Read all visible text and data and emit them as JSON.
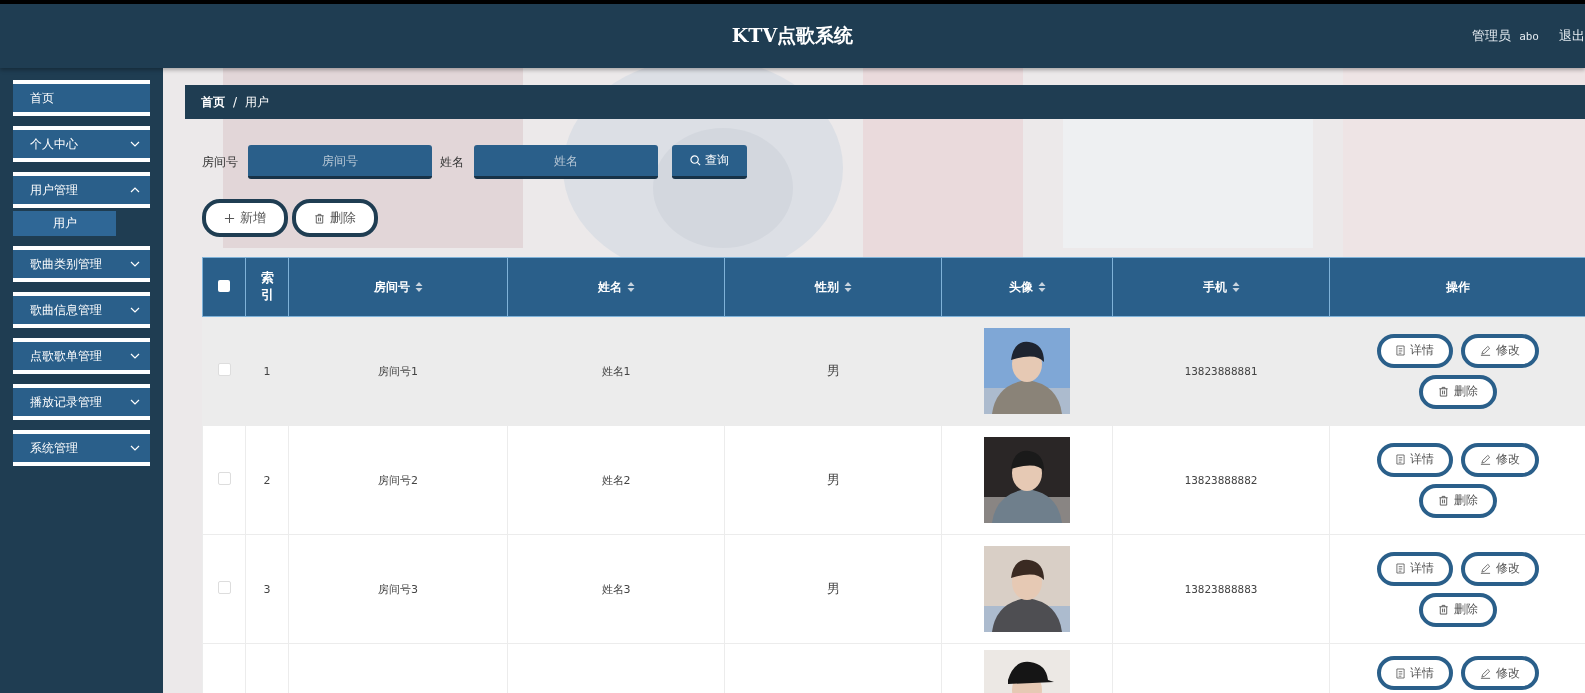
{
  "header": {
    "title": "KTV点歌系统",
    "user_role": "管理员",
    "user_name": "abo",
    "logout": "退出"
  },
  "sidebar": {
    "items": [
      {
        "label": "首页"
      },
      {
        "label": "个人中心",
        "expanded": false
      },
      {
        "label": "用户管理",
        "expanded": true,
        "children": [
          {
            "label": "用户",
            "selected": true
          }
        ]
      },
      {
        "label": "歌曲类别管理",
        "expanded": false
      },
      {
        "label": "歌曲信息管理",
        "expanded": false
      },
      {
        "label": "点歌歌单管理",
        "expanded": false
      },
      {
        "label": "播放记录管理",
        "expanded": false
      },
      {
        "label": "系统管理",
        "expanded": false
      }
    ]
  },
  "breadcrumb": {
    "items": [
      "首页",
      "用户"
    ],
    "separator": "/"
  },
  "search": {
    "fields": [
      {
        "label": "房间号",
        "placeholder": "房间号"
      },
      {
        "label": "姓名",
        "placeholder": "姓名"
      }
    ],
    "button": "查询"
  },
  "actions": [
    {
      "kind": "add",
      "label": "新增"
    },
    {
      "kind": "delete",
      "label": "删除"
    }
  ],
  "table": {
    "select_all_checked": false,
    "columns": [
      {
        "label": "索引",
        "sortable": false
      },
      {
        "label": "房间号",
        "sortable": true
      },
      {
        "label": "姓名",
        "sortable": true
      },
      {
        "label": "性别",
        "sortable": true
      },
      {
        "label": "头像",
        "sortable": true
      },
      {
        "label": "手机",
        "sortable": true
      },
      {
        "label": "操作",
        "sortable": false
      }
    ],
    "rows": [
      {
        "checked": false,
        "hovered": true,
        "index": "1",
        "room": "房间号1",
        "name": "姓名1",
        "gender": "男",
        "phone": "13823888881",
        "buttons": [
          {
            "kind": "detail",
            "label": "详情"
          },
          {
            "kind": "edit",
            "label": "修改"
          },
          {
            "kind": "delete",
            "label": "删除"
          }
        ]
      },
      {
        "checked": false,
        "hovered": false,
        "index": "2",
        "room": "房间号2",
        "name": "姓名2",
        "gender": "男",
        "phone": "13823888882",
        "buttons": [
          {
            "kind": "detail",
            "label": "详情"
          },
          {
            "kind": "edit",
            "label": "修改"
          },
          {
            "kind": "delete",
            "label": "删除"
          }
        ]
      },
      {
        "checked": false,
        "hovered": false,
        "index": "3",
        "room": "房间号3",
        "name": "姓名3",
        "gender": "男",
        "phone": "13823888883",
        "buttons": [
          {
            "kind": "detail",
            "label": "详情"
          },
          {
            "kind": "edit",
            "label": "修改"
          },
          {
            "kind": "delete",
            "label": "删除"
          }
        ]
      }
    ],
    "partial_row": {
      "buttons": [
        {
          "kind": "detail",
          "label": "详情"
        },
        {
          "kind": "edit",
          "label": "修改"
        }
      ]
    }
  }
}
